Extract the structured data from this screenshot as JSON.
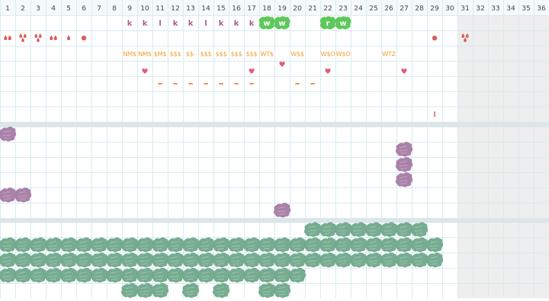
{
  "header": {
    "days": [
      "1",
      "2",
      "3",
      "4",
      "5",
      "6",
      "7",
      "8",
      "9",
      "10",
      "11",
      "12",
      "13",
      "14",
      "15",
      "16",
      "17",
      "18",
      "19",
      "20",
      "21",
      "22",
      "23",
      "24",
      "25",
      "26",
      "27",
      "28",
      "29",
      "30",
      "31",
      "32",
      "33",
      "34",
      "35",
      "36"
    ]
  },
  "grid": {
    "active_days": 30,
    "line_color": "#d6e9ef",
    "header_color": "#f4fafb",
    "inactive_color": "#eeeeee",
    "separator_color": "#dfe4e6"
  },
  "colors": {
    "letter": "#a4648f",
    "drop": "#e05a5a",
    "money": "#f0a030",
    "heart": "#e25c7a",
    "dash": "#f08a4a",
    "tick": "#e05a5a",
    "green_badge": "#5ec85a",
    "purple_blob": "#a57ba4",
    "teal_blob": "#6fa88a"
  },
  "section1": {
    "letter_row": [
      {
        "day": 9,
        "text": "k"
      },
      {
        "day": 10,
        "text": "k"
      },
      {
        "day": 11,
        "text": "l"
      },
      {
        "day": 12,
        "text": "k"
      },
      {
        "day": 13,
        "text": "k"
      },
      {
        "day": 14,
        "text": "l"
      },
      {
        "day": 15,
        "text": "k"
      },
      {
        "day": 16,
        "text": "k"
      },
      {
        "day": 17,
        "text": "k"
      }
    ],
    "badge_row": [
      {
        "day": 18,
        "text": "w"
      },
      {
        "day": 19,
        "text": "w"
      },
      {
        "day": 22,
        "text": "r"
      },
      {
        "day": 23,
        "text": "w"
      }
    ],
    "drop_row": [
      {
        "day": 1,
        "icon": "drops-two"
      },
      {
        "day": 2,
        "icon": "drops-three"
      },
      {
        "day": 3,
        "icon": "drops-three"
      },
      {
        "day": 4,
        "icon": "drops-two"
      },
      {
        "day": 5,
        "icon": "drop-one"
      },
      {
        "day": 6,
        "icon": "dot"
      },
      {
        "day": 29,
        "icon": "dot"
      },
      {
        "day": 31,
        "icon": "drops-three"
      }
    ],
    "money_row": [
      {
        "day": 9,
        "text": "NM$"
      },
      {
        "day": 10,
        "text": "NM$"
      },
      {
        "day": 11,
        "text": "$M$"
      },
      {
        "day": 12,
        "text": "$$$"
      },
      {
        "day": 13,
        "text": "$$-"
      },
      {
        "day": 14,
        "text": "$$$"
      },
      {
        "day": 15,
        "text": "$$$"
      },
      {
        "day": 16,
        "text": "$$$"
      },
      {
        "day": 17,
        "text": "$$$"
      },
      {
        "day": 18,
        "text": "WT$"
      },
      {
        "day": 20,
        "text": "W$$"
      },
      {
        "day": 22,
        "text": "W$O"
      },
      {
        "day": 23,
        "text": "W$O"
      },
      {
        "day": 26,
        "text": "WTZ"
      }
    ],
    "heart_row_a": [
      19
    ],
    "heart_row_b": [
      10,
      17,
      22,
      27
    ],
    "dash_row": [
      11,
      12,
      13,
      14,
      15,
      16,
      17,
      20,
      21
    ],
    "tick_row": [
      29
    ]
  },
  "section2": {
    "blobs": [
      {
        "day": 1,
        "row": 0
      },
      {
        "day": 27,
        "row": 1
      },
      {
        "day": 27,
        "row": 2
      },
      {
        "day": 27,
        "row": 3
      },
      {
        "day": 1,
        "row": 4
      },
      {
        "day": 2,
        "row": 4
      },
      {
        "day": 19,
        "row": 5
      }
    ]
  },
  "section3": {
    "rows": [
      {
        "from": 21,
        "to": 28,
        "extra": []
      },
      {
        "from": 1,
        "to": 29,
        "extra": []
      },
      {
        "from": 1,
        "to": 29,
        "extra": []
      },
      {
        "from": 1,
        "to": 20,
        "extra": []
      },
      {
        "from": 0,
        "to": -1,
        "extra": [
          9,
          10,
          11,
          13,
          15,
          18,
          19
        ]
      }
    ]
  }
}
